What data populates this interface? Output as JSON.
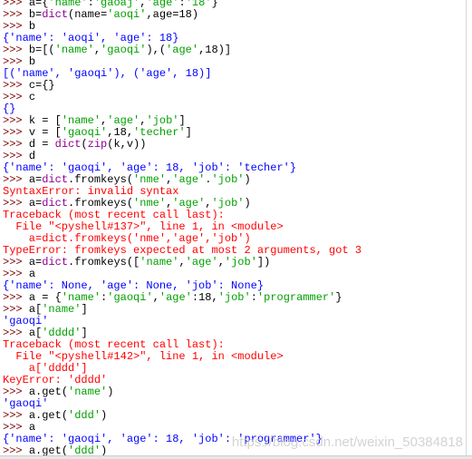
{
  "prompt": ">>> ",
  "builtins": [
    "dict",
    "zip"
  ],
  "colors": {
    "prompt": "#800000",
    "string": "#00a000",
    "builtin": "#900090",
    "output": "#0000ff",
    "error": "#ff0000",
    "code": "#000000"
  },
  "watermark": "https://blog.csdn.net/weixin_50384818",
  "lines": [
    {
      "type": "input",
      "text": "a={'name':'gaoaj','age':'18'}"
    },
    {
      "type": "input",
      "text": "b=dict(name='aoqi',age=18)"
    },
    {
      "type": "input",
      "text": "b"
    },
    {
      "type": "output",
      "text": "{'name': 'aoqi', 'age': 18}"
    },
    {
      "type": "input",
      "text": "b=[('name','gaoqi'),('age',18)]"
    },
    {
      "type": "input",
      "text": "b"
    },
    {
      "type": "output",
      "text": "[('name', 'gaoqi'), ('age', 18)]"
    },
    {
      "type": "input",
      "text": "c={}"
    },
    {
      "type": "input",
      "text": "c"
    },
    {
      "type": "output",
      "text": "{}"
    },
    {
      "type": "input",
      "text": "k = ['name','age','job']"
    },
    {
      "type": "input",
      "text": "v = ['gaoqi',18,'techer']"
    },
    {
      "type": "input",
      "text": "d = dict(zip(k,v))"
    },
    {
      "type": "input",
      "text": "d"
    },
    {
      "type": "output",
      "text": "{'name': 'gaoqi', 'age': 18, 'job': 'techer'}"
    },
    {
      "type": "input",
      "text": "a=dict.fromkeys('nme','age'.'job')"
    },
    {
      "type": "error",
      "text": "SyntaxError: invalid syntax"
    },
    {
      "type": "input",
      "text": "a=dict.fromkeys('nme','age','job')"
    },
    {
      "type": "error",
      "text": "Traceback (most recent call last):"
    },
    {
      "type": "error",
      "text": "  File \"<pyshell#137>\", line 1, in <module>"
    },
    {
      "type": "error",
      "text": "    a=dict.fromkeys('nme','age','job')"
    },
    {
      "type": "error",
      "text": "TypeError: fromkeys expected at most 2 arguments, got 3"
    },
    {
      "type": "input",
      "text": "a=dict.fromkeys(['name','age','job'])"
    },
    {
      "type": "input",
      "text": "a"
    },
    {
      "type": "output",
      "text": "{'name': None, 'age': None, 'job': None}"
    },
    {
      "type": "input",
      "text": "a = {'name':'gaoqi','age':18,'job':'programmer'}"
    },
    {
      "type": "input",
      "text": "a['name']"
    },
    {
      "type": "output",
      "text": "'gaoqi'"
    },
    {
      "type": "input",
      "text": "a['dddd']"
    },
    {
      "type": "error",
      "text": "Traceback (most recent call last):"
    },
    {
      "type": "error",
      "text": "  File \"<pyshell#142>\", line 1, in <module>"
    },
    {
      "type": "error",
      "text": "    a['dddd']"
    },
    {
      "type": "error",
      "text": "KeyError: 'dddd'"
    },
    {
      "type": "input",
      "text": "a.get('name')"
    },
    {
      "type": "output",
      "text": "'gaoqi'"
    },
    {
      "type": "input",
      "text": "a.get('ddd')"
    },
    {
      "type": "input",
      "text": "a"
    },
    {
      "type": "output",
      "text": "{'name': 'gaoqi', 'age': 18, 'job': 'programmer'}"
    },
    {
      "type": "input",
      "text": "a.get('ddd')"
    }
  ]
}
